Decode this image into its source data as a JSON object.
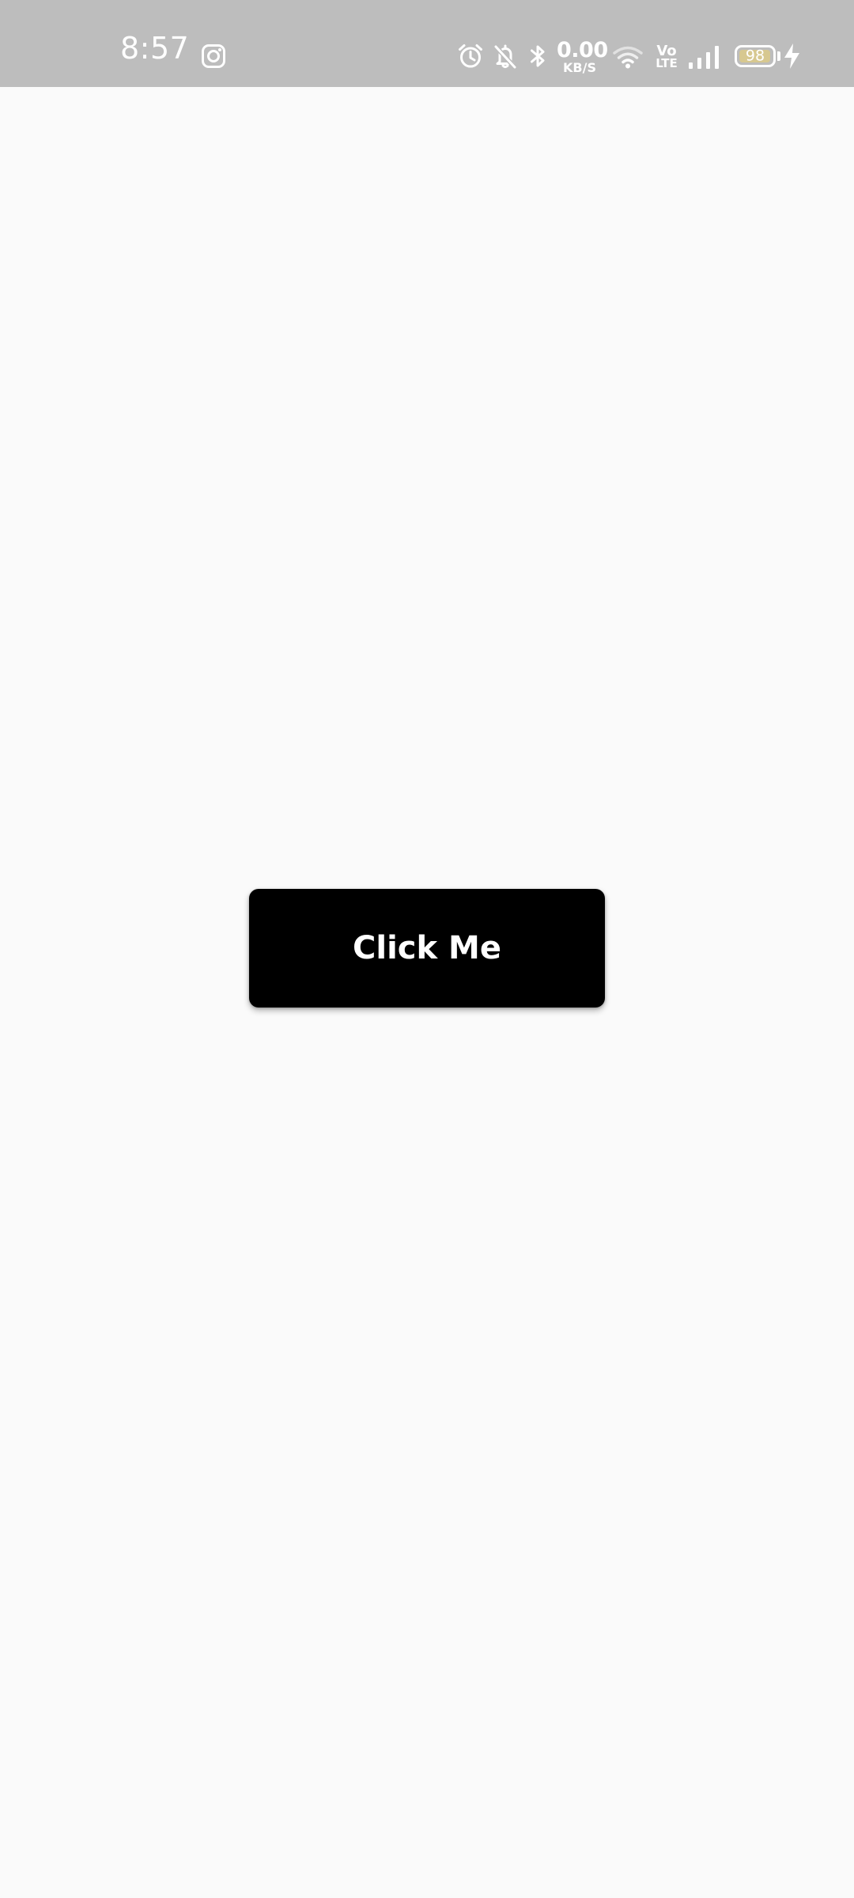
{
  "status_bar": {
    "background": "#bdbdbd",
    "time": "8:57",
    "notification_icons": [
      "instagram-icon"
    ],
    "system_icons": [
      "alarm-icon",
      "bell-off-icon",
      "bluetooth-icon",
      "wifi-icon",
      "volte-icon",
      "cellular-signal-icon",
      "battery-icon",
      "charging-bolt-icon"
    ],
    "network_speed": {
      "value": "0.00",
      "unit": "KB/S"
    },
    "volte": {
      "top": "Vo",
      "bottom": "LTE"
    },
    "battery": {
      "level": "98",
      "fill_fraction": 0.98,
      "charging": true,
      "fill_color": "#d7c890"
    }
  },
  "main": {
    "background": "#fafafa",
    "button": {
      "label": "Click Me",
      "background": "#000000",
      "text_color": "#ffffff"
    }
  }
}
